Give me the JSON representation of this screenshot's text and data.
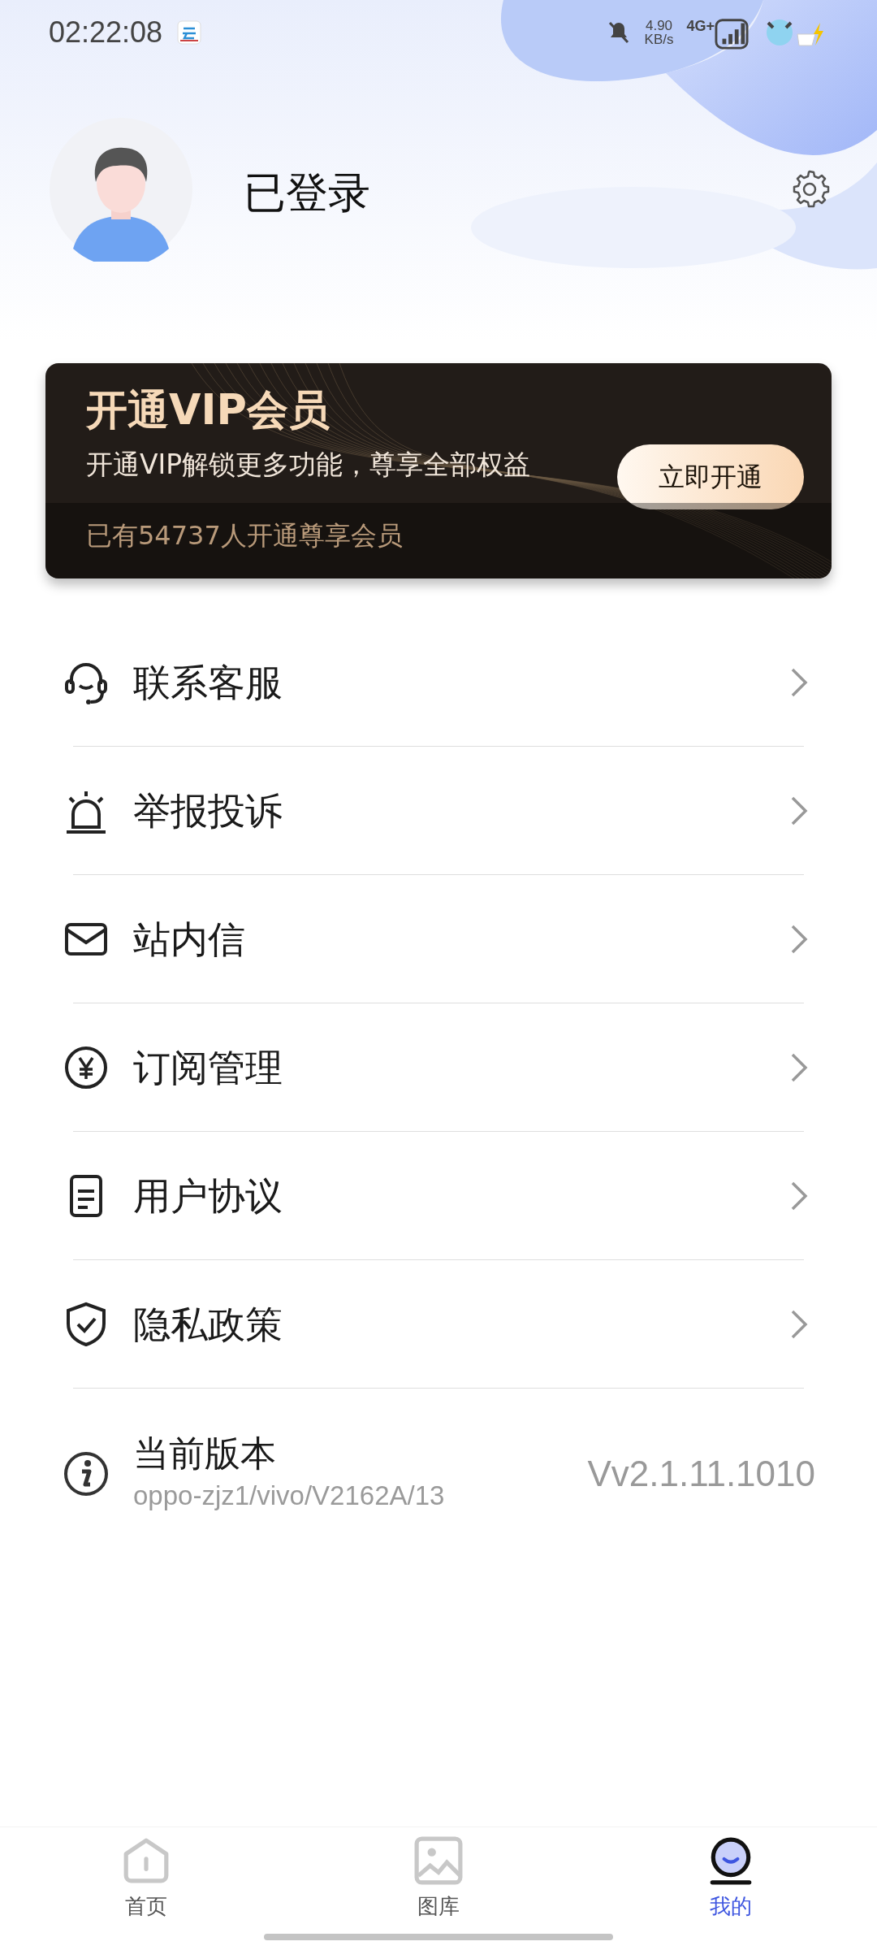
{
  "status_bar": {
    "time": "02:22:08",
    "speed_value": "4.90",
    "speed_unit": "KB/s",
    "network": "4G+"
  },
  "profile": {
    "name": "已登录"
  },
  "vip": {
    "title": "开通VIP会员",
    "subtitle": "开通VIP解锁更多功能，尊享全部权益",
    "button": "立即开通",
    "members": "已有54737人开通尊享会员"
  },
  "menu": [
    {
      "label": "联系客服"
    },
    {
      "label": "举报投诉"
    },
    {
      "label": "站内信"
    },
    {
      "label": "订阅管理"
    },
    {
      "label": "用户协议"
    },
    {
      "label": "隐私政策"
    }
  ],
  "version": {
    "label": "当前版本",
    "detail": "oppo-zjz1/vivo/V2162A/13",
    "value": "Vv2.1.11.1010"
  },
  "tabs": [
    {
      "label": "首页",
      "selected": false
    },
    {
      "label": "图库",
      "selected": false
    },
    {
      "label": "我的",
      "selected": true
    }
  ]
}
